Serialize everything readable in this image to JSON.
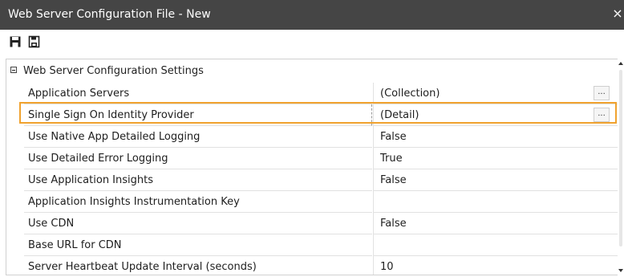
{
  "window": {
    "title": "Web Server Configuration File - New",
    "close_glyph": "×"
  },
  "toolbar": {
    "buttons": [
      {
        "icon": "save-icon"
      },
      {
        "icon": "save-as-icon"
      }
    ]
  },
  "property_grid": {
    "category": {
      "label": "Web Server Configuration Settings",
      "expanded": true
    },
    "ellipsis_label": "...",
    "selected_color": "#f0a22e",
    "rows": [
      {
        "name": "Application Servers",
        "value": "(Collection)",
        "has_ellipsis": true,
        "selected": false
      },
      {
        "name": "Single Sign On Identity Provider",
        "value": "(Detail)",
        "has_ellipsis": true,
        "selected": true
      },
      {
        "name": "Use Native App Detailed Logging",
        "value": "False",
        "has_ellipsis": false,
        "selected": false
      },
      {
        "name": "Use Detailed Error Logging",
        "value": "True",
        "has_ellipsis": false,
        "selected": false
      },
      {
        "name": "Use Application Insights",
        "value": "False",
        "has_ellipsis": false,
        "selected": false
      },
      {
        "name": "Application Insights Instrumentation Key",
        "value": "",
        "has_ellipsis": false,
        "selected": false
      },
      {
        "name": "Use CDN",
        "value": "False",
        "has_ellipsis": false,
        "selected": false
      },
      {
        "name": "Base URL for CDN",
        "value": "",
        "has_ellipsis": false,
        "selected": false
      },
      {
        "name": "Server Heartbeat Update Interval (seconds)",
        "value": "10",
        "has_ellipsis": false,
        "selected": false
      }
    ]
  }
}
